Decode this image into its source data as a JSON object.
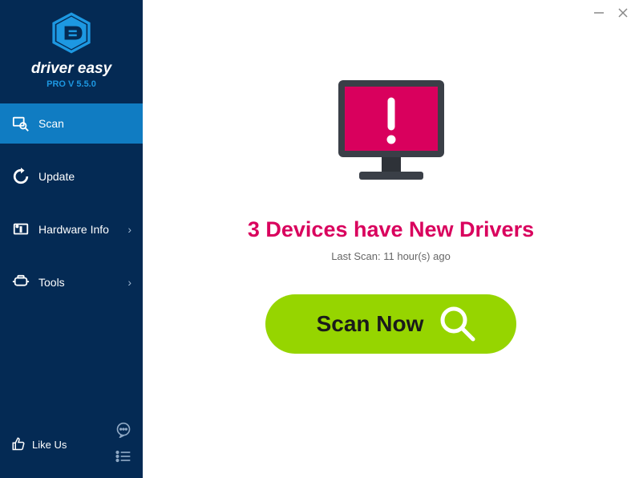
{
  "brand": {
    "name_line1": "driver easy",
    "version_label": "PRO V 5.5.0"
  },
  "sidebar": {
    "items": [
      {
        "label": "Scan",
        "has_submenu": false
      },
      {
        "label": "Update",
        "has_submenu": false
      },
      {
        "label": "Hardware Info",
        "has_submenu": true
      },
      {
        "label": "Tools",
        "has_submenu": true
      }
    ],
    "like_us_label": "Like Us"
  },
  "main": {
    "headline": "3 Devices have New Drivers",
    "last_scan": "Last Scan: 11 hour(s) ago",
    "scan_button_label": "Scan Now"
  },
  "colors": {
    "sidebar_bg": "#042a54",
    "sidebar_active": "#107cc2",
    "accent_pink": "#d9005d",
    "scan_green": "#96d500",
    "brand_blue": "#1d98e2"
  }
}
